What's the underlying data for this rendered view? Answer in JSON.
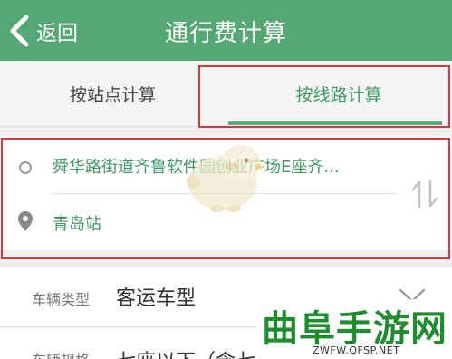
{
  "header": {
    "back_label": "返回",
    "title": "通行费计算"
  },
  "tabs": [
    {
      "label": "按站点计算",
      "active": false
    },
    {
      "label": "按线路计算",
      "active": true
    }
  ],
  "route": {
    "origin": "舜华路街道齐鲁软件园创业广场E座齐...",
    "destination": "青岛站"
  },
  "vehicle": {
    "type_label": "车辆类型",
    "type_value": "客运车型",
    "spec_label": "车辆规格",
    "spec_value": "七座以下（含七"
  },
  "watermark": {
    "site_name": "曲阜手游网",
    "site_url": "ZWFW.QFSP.NET"
  },
  "colors": {
    "accent": "#55a874",
    "active_text": "#3d9a63",
    "highlight_border": "#d8373b"
  }
}
